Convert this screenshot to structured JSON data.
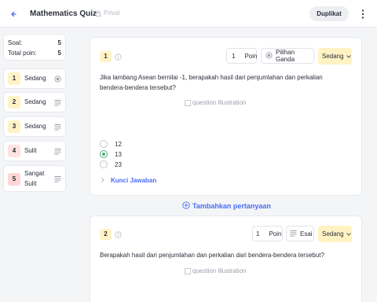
{
  "header": {
    "title": "Mathematics Quiz",
    "privacy": "Privat",
    "duplicate_label": "Duplikat"
  },
  "stats": {
    "questions_label": "Soal:",
    "questions_value": "5",
    "points_label": "Total poin:",
    "points_value": "5"
  },
  "question_nav": [
    {
      "number": "1",
      "label": "Sedang",
      "num_bg": "#fff3c4",
      "num_color": "#2b2f3a"
    },
    {
      "number": "2",
      "label": "Sedang",
      "num_bg": "#fff3c4",
      "num_color": "#2b2f3a"
    },
    {
      "number": "3",
      "label": "Sedang",
      "num_bg": "#fff3c4",
      "num_color": "#2b2f3a"
    },
    {
      "number": "4",
      "label": "Sulit",
      "num_bg": "#ffe3e3",
      "num_color": "#2b2f3a"
    },
    {
      "number": "5",
      "label_line1": "Sangat",
      "label_line2": "Sulit",
      "num_bg": "#ffd6d6",
      "num_color": "#2b2f3a"
    }
  ],
  "questions": [
    {
      "number": "1",
      "points_value": "1",
      "points_label": "Poin",
      "type_label": "Pilihan Ganda",
      "difficulty": "Sedang",
      "text": "Jika lambang Asean bernilai -1, berapakah hasil dari penjumlahan dan perkalian bendera-bendera tersebut?",
      "image_alt": "question illustration",
      "options": [
        "12",
        "13",
        "23"
      ],
      "selected_option": "13",
      "answer_key_label": "Kunci Jawaban"
    },
    {
      "number": "2",
      "points_value": "1",
      "points_label": "Poin",
      "type_label": "Esai",
      "difficulty": "Sedang",
      "text": "Berapakah hasil dari penjumlahan dan perkalian dari bendera-bendera tersebut?",
      "image_alt": "question illustration"
    }
  ],
  "add_question_label": "Tambahkan pertanyaan",
  "colors": {
    "accent": "#4a6cf7",
    "difficulty_bg": "#fff3c4",
    "correct": "#4caf7a"
  }
}
